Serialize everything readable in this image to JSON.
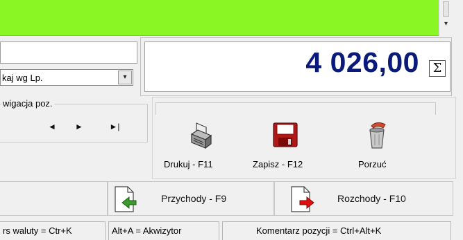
{
  "header": {
    "scroll_arrow": "▾"
  },
  "filter": {
    "combo_value": "kaj wg Lp.",
    "combo_arrow": "▾"
  },
  "totals": {
    "value": "4 026,00",
    "sigma": "Σ"
  },
  "navigation": {
    "title": "wigacja poz.",
    "prev": "◄",
    "next": "►",
    "last": "►|"
  },
  "actions": {
    "print_label": "Drukuj - F11",
    "save_label": "Zapisz  - F12",
    "discard_label": "Porzuć"
  },
  "documents": {
    "income_label": "Przychody - F9",
    "expense_label": "Rozchody - F10"
  },
  "statusbar": {
    "currency_hint": "rs waluty = Ctr+K",
    "acquirer_hint": "Alt+A = Akwizytor",
    "comment_hint": "Komentarz pozycji = Ctrl+Alt+K"
  },
  "colors": {
    "header_bar": "#8af724",
    "total_text": "#0a1a7a",
    "save_icon": "#b01818",
    "income_arrow": "#3a9a2a",
    "expense_arrow": "#e01010"
  }
}
